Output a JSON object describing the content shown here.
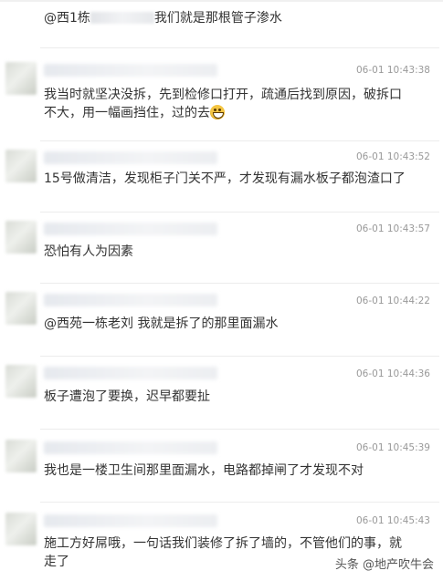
{
  "comments": [
    {
      "time": "",
      "text_pre": "@西1栋",
      "text_post": "我们就是那根管子渗水"
    },
    {
      "time": "06-01 10:43:38",
      "text": "我当时就坚决没拆，先到检修口打开，疏通后找到原因，破拆口不大，用一幅画挡住，过的去"
    },
    {
      "time": "06-01 10:43:52",
      "text": "15号做清洁，发现柜子门关不严，才发现有漏水板子都泡渣口了"
    },
    {
      "time": "06-01 10:43:57",
      "text": "恐怕有人为因素"
    },
    {
      "time": "06-01 10:44:22",
      "text": "@西苑一栋老刘 我就是拆了的那里面漏水"
    },
    {
      "time": "06-01 10:44:36",
      "text": "板子遭泡了要换，迟早都要扯"
    },
    {
      "time": "06-01 10:45:39",
      "text": "我也是一楼卫生间那里面漏水，电路都掉闸了才发现不对"
    },
    {
      "time": "06-01 10:45:43",
      "text": "施工方好屌哦，一句话我们装修了拆了墙的，不管他们的事，就走了"
    }
  ],
  "watermark": "头条 @地产吹牛会",
  "emoji_icon": "grinning-face-icon"
}
